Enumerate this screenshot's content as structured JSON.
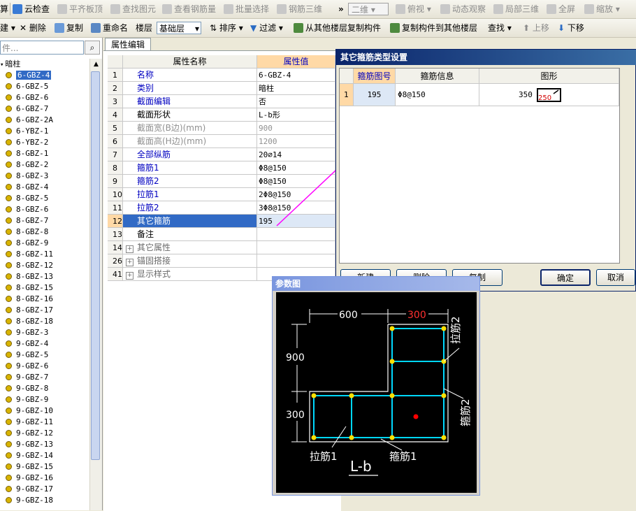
{
  "toolbar1": {
    "calc": "算",
    "cloud_check": "云检查",
    "flat_slab": "平齐板顶",
    "find_element": "查找图元",
    "view_rebar": "查看钢筋量",
    "batch_select": "批量选择",
    "rebar_3d": "钢筋三维",
    "more": "»",
    "view_mode": "二维",
    "top_view": "俯视",
    "dynamic_observe": "动态观察",
    "local_3d": "局部三维",
    "fullscreen": "全屏",
    "zoom": "缩放"
  },
  "toolbar2": {
    "new": "建",
    "delete": "删除",
    "copy": "复制",
    "rename": "重命名",
    "floor_label": "楼层",
    "floor_value": "基础层",
    "sort": "排序",
    "filter": "过滤",
    "copy_from_floor": "从其他楼层复制构件",
    "copy_to_floor": "复制构件到其他楼层",
    "find": "查找",
    "move_up": "上移",
    "move_down": "下移"
  },
  "search": {
    "placeholder": "件..."
  },
  "tree": {
    "root": "暗柱",
    "items": [
      "6-GBZ-4",
      "6-GBZ-5",
      "6-GBZ-6",
      "6-GBZ-7",
      "6-GBZ-2A",
      "6-YBZ-1",
      "6-YBZ-2",
      "8-GBZ-1",
      "8-GBZ-2",
      "8-GBZ-3",
      "8-GBZ-4",
      "8-GBZ-5",
      "8-GBZ-6",
      "8-GBZ-7",
      "8-GBZ-8",
      "8-GBZ-9",
      "8-GBZ-11",
      "8-GBZ-12",
      "8-GBZ-13",
      "8-GBZ-15",
      "8-GBZ-16",
      "8-GBZ-17",
      "8-GBZ-18",
      "9-GBZ-3",
      "9-GBZ-4",
      "9-GBZ-5",
      "9-GBZ-6",
      "9-GBZ-7",
      "9-GBZ-8",
      "9-GBZ-9",
      "9-GBZ-10",
      "9-GBZ-11",
      "9-GBZ-12",
      "9-GBZ-13",
      "9-GBZ-14",
      "9-GBZ-15",
      "9-GBZ-16",
      "9-GBZ-17",
      "9-GBZ-18"
    ],
    "selected": "6-GBZ-4"
  },
  "props": {
    "tab": "属性编辑",
    "col_name": "属性名称",
    "col_value": "属性值",
    "rows": [
      {
        "num": "1",
        "name": "名称",
        "value": "6-GBZ-4",
        "style": "blue"
      },
      {
        "num": "2",
        "name": "类别",
        "value": "暗柱",
        "style": "blue"
      },
      {
        "num": "3",
        "name": "截面编辑",
        "value": "否",
        "style": "blue"
      },
      {
        "num": "4",
        "name": "截面形状",
        "value": "L-b形",
        "style": ""
      },
      {
        "num": "5",
        "name": "截面宽(B边)(mm)",
        "value": "900",
        "style": "gray"
      },
      {
        "num": "6",
        "name": "截面高(H边)(mm)",
        "value": "1200",
        "style": "gray"
      },
      {
        "num": "7",
        "name": "全部纵筋",
        "value": "20⌀14",
        "style": "blue"
      },
      {
        "num": "8",
        "name": "箍筋1",
        "value": "Φ8@150",
        "style": "blue"
      },
      {
        "num": "9",
        "name": "箍筋2",
        "value": "Φ8@150",
        "style": "blue"
      },
      {
        "num": "10",
        "name": "拉筋1",
        "value": "2Φ8@150",
        "style": "blue"
      },
      {
        "num": "11",
        "name": "拉筋2",
        "value": "3Φ8@150",
        "style": "blue"
      },
      {
        "num": "12",
        "name": "其它箍筋",
        "value": "195",
        "style": "selected"
      },
      {
        "num": "13",
        "name": "备注",
        "value": "",
        "style": ""
      },
      {
        "num": "14",
        "name": "其它属性",
        "value": "",
        "style": "group"
      },
      {
        "num": "26",
        "name": "锚固搭接",
        "value": "",
        "style": "group"
      },
      {
        "num": "41",
        "name": "显示样式",
        "value": "",
        "style": "group"
      }
    ]
  },
  "dialog": {
    "title": "其它箍筋类型设置",
    "col_shape_no": "箍筋图号",
    "col_info": "箍筋信息",
    "col_shape": "图形",
    "row": {
      "num": "1",
      "shape_no": "195",
      "info": "Φ8@150",
      "dim1": "350",
      "dim2": "250"
    },
    "btn_new": "新建",
    "btn_delete": "删除",
    "btn_copy": "复制",
    "btn_ok": "确定",
    "btn_cancel": "取消"
  },
  "param_figure": {
    "title": "参数图",
    "dim_top_left": "600",
    "dim_top_right": "300",
    "dim_left_upper": "900",
    "dim_left_lower": "300",
    "label_tie2": "拉筋2",
    "label_stirrup2": "箍筋2",
    "label_tie1": "拉筋1",
    "label_stirrup1": "箍筋1",
    "shape_name": "L-b"
  },
  "colors": {
    "selection": "#316ac5",
    "arrow": "#ff00ff",
    "rebar": "#00d8ff",
    "bar_dot": "#ffe000"
  }
}
